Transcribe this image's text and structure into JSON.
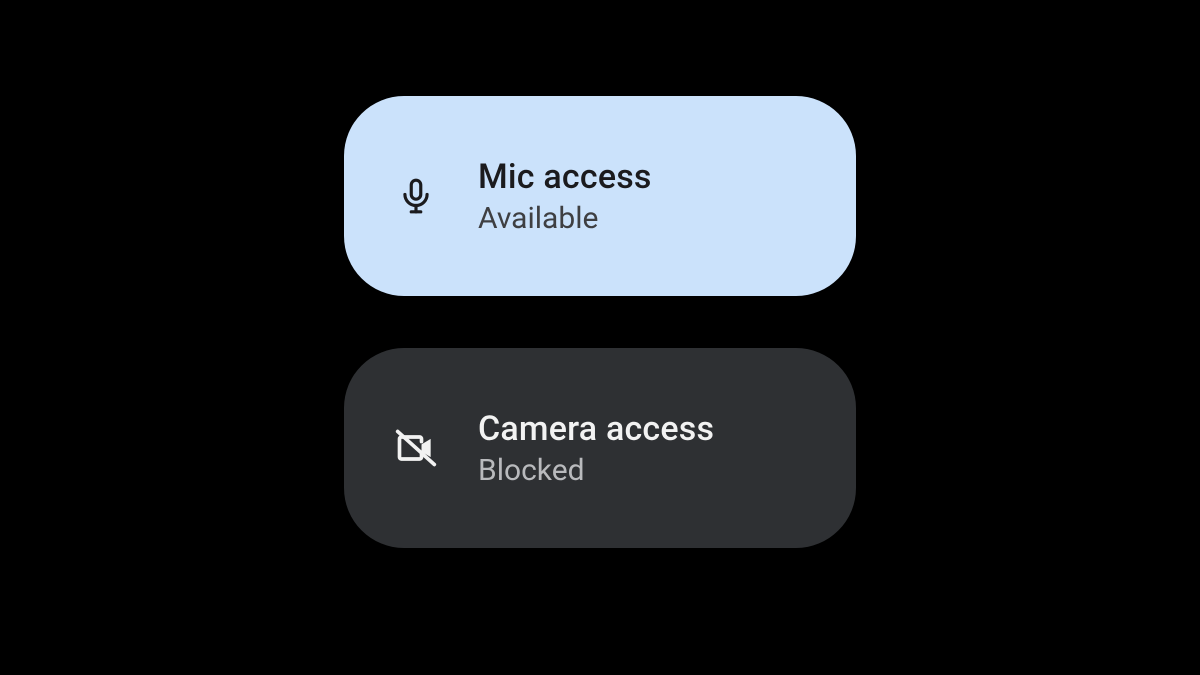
{
  "tiles": {
    "mic": {
      "title": "Mic access",
      "status": "Available"
    },
    "camera": {
      "title": "Camera access",
      "status": "Blocked"
    }
  },
  "colors": {
    "tile_light_bg": "#CBE2FB",
    "tile_dark_bg": "#2E3033",
    "light_title": "#1B1B1E",
    "light_sub": "#3E3F42",
    "dark_title": "#F2F2F2",
    "dark_sub": "#B9BABD",
    "page_bg": "#000000"
  },
  "icons": {
    "mic": "microphone-icon",
    "camera_blocked": "camera-off-icon"
  }
}
